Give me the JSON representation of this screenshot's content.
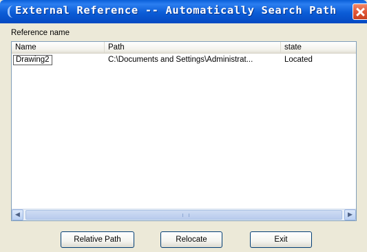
{
  "window": {
    "title": "External Reference -- Automatically Search Path"
  },
  "group": {
    "label": "Reference name"
  },
  "list": {
    "columns": [
      "Name",
      "Path",
      "state"
    ],
    "rows": [
      {
        "name": "Drawing2",
        "path": "C:\\Documents and Settings\\Administrat...",
        "state": "Located"
      }
    ]
  },
  "buttons": {
    "relative_path": "Relative Path",
    "relocate": "Relocate",
    "exit": "Exit"
  },
  "scrollbar": {
    "left_arrow": "◀",
    "right_arrow": "▶"
  },
  "colors": {
    "titlebar": "#0a5fd8",
    "close": "#e1583a",
    "dialog_bg": "#ece9d8"
  }
}
